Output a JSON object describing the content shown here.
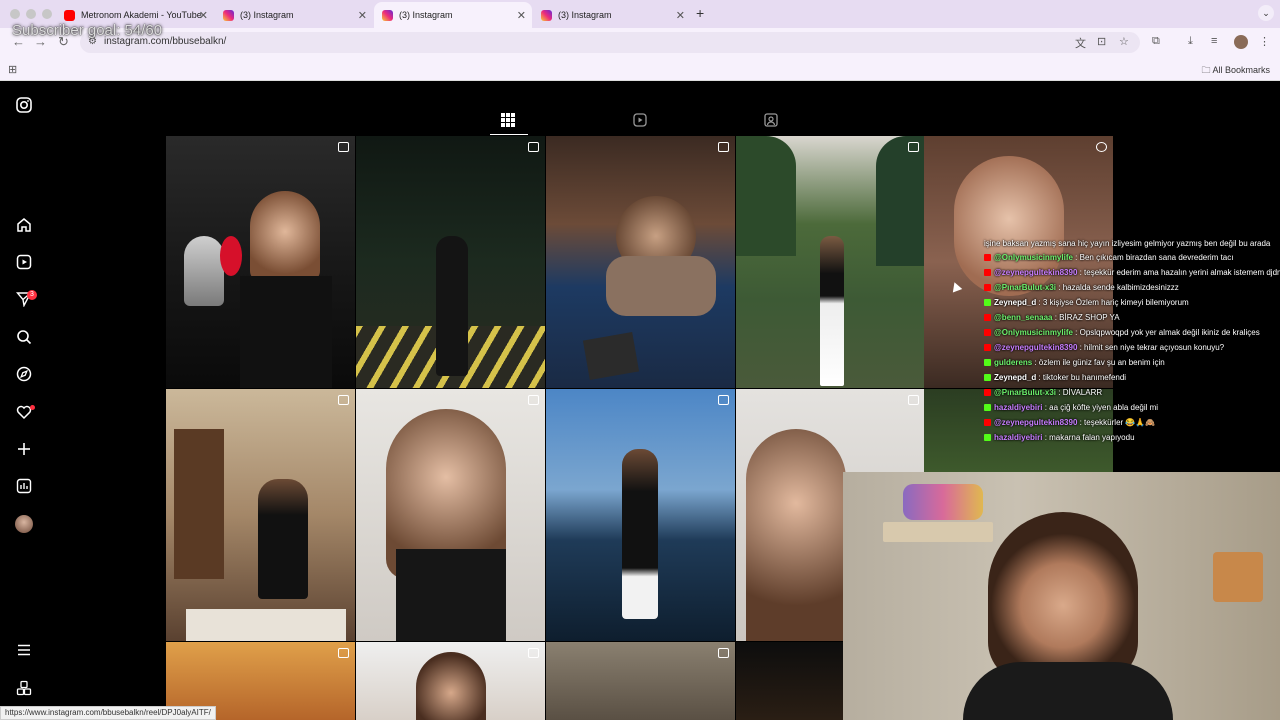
{
  "overlay": {
    "subscriber_goal": "Subscriber goal: 54/60"
  },
  "browser": {
    "tabs": [
      {
        "title": "Metronom Akademi - YouTube",
        "icon": "youtube-icon",
        "active": false
      },
      {
        "title": "(3) Instagram",
        "icon": "instagram-icon",
        "active": false
      },
      {
        "title": "(3) Instagram",
        "icon": "instagram-icon",
        "active": true
      },
      {
        "title": "(3) Instagram",
        "icon": "instagram-icon",
        "active": false
      }
    ],
    "url": "instagram.com/bbusebalkn/",
    "all_bookmarks": "All Bookmarks",
    "status_url": "https://www.instagram.com/bbusebalkn/reel/DPJ0alyAITF/"
  },
  "instagram": {
    "notification_count": "3",
    "sidebar_icons": [
      "instagram-logo-icon",
      "home-icon",
      "reels-icon",
      "messages-icon",
      "search-icon",
      "explore-icon",
      "notifications-icon",
      "create-icon",
      "dashboard-icon",
      "profile-avatar",
      "more-menu-icon",
      "threads-icon"
    ],
    "profile_tabs": [
      "posts-grid-icon",
      "reels-tab-icon",
      "tagged-tab-icon"
    ]
  },
  "chat": {
    "first_message": "işine baksan yazmış sana hiç yayın izliyesim gelmiyor yazmış ben değil bu arada",
    "messages": [
      {
        "user": "@Onlymusicinmylife",
        "text": " : Ben çıkıcam birazdan sana devrederim tacı",
        "color": "#6cf06c",
        "icon": "youtube"
      },
      {
        "user": "@zeynepgultekin8390",
        "text": " : teşekkür ederim ama hazalın yerini almak istemem djdmdoskdös",
        "color": "#c77dff",
        "icon": "youtube"
      },
      {
        "user": "@PınarBulut-x3i",
        "text": " : hazalda sende kalbimizdesinizzz",
        "color": "#6cf06c",
        "icon": "youtube"
      },
      {
        "user": "Zeynepd_d",
        "text": " : 3 kişiyse Özlem hariç kimeyi bilemiyorum",
        "color": "#ffffff",
        "icon": "kick"
      },
      {
        "user": "@benn_senaaa",
        "text": " : BİRAZ SHOP YA",
        "color": "#6cf06c",
        "icon": "youtube"
      },
      {
        "user": "@Onlymusicinmylife",
        "text": " : Opslqpwoqpd yok yer almak değil ikiniz de kraliçes",
        "color": "#6cf06c",
        "icon": "youtube"
      },
      {
        "user": "@zeynepgultekin8390",
        "text": " : hilmit sen niye tekrar açıyosun konuyu?",
        "color": "#c77dff",
        "icon": "youtube"
      },
      {
        "user": "gulderens",
        "text": " : özlem ile güniz fav şu an benim için",
        "color": "#6cf06c",
        "icon": "kick"
      },
      {
        "user": "Zeynepd_d",
        "text": " : tiktoker bu hanımefendi",
        "color": "#ffffff",
        "icon": "kick"
      },
      {
        "user": "@PınarBulut-x3i",
        "text": " : DİVALARR",
        "color": "#6cf06c",
        "icon": "youtube"
      },
      {
        "user": "hazaldiyebiri",
        "text": " : aa çiğ köfte yiyen abla değil mi",
        "color": "#c77dff",
        "icon": "kick"
      },
      {
        "user": "@zeynepgultekin8390",
        "text": " : teşekkürler 😂🙏🙈",
        "color": "#c77dff",
        "icon": "youtube"
      },
      {
        "user": "hazaldiyebiri",
        "text": " : makarna falan yapıyodu",
        "color": "#c77dff",
        "icon": "kick"
      }
    ]
  },
  "colors": {
    "accent_red": "#ff3040",
    "youtube_red": "#ff0000",
    "kick_green": "#53fc18"
  }
}
